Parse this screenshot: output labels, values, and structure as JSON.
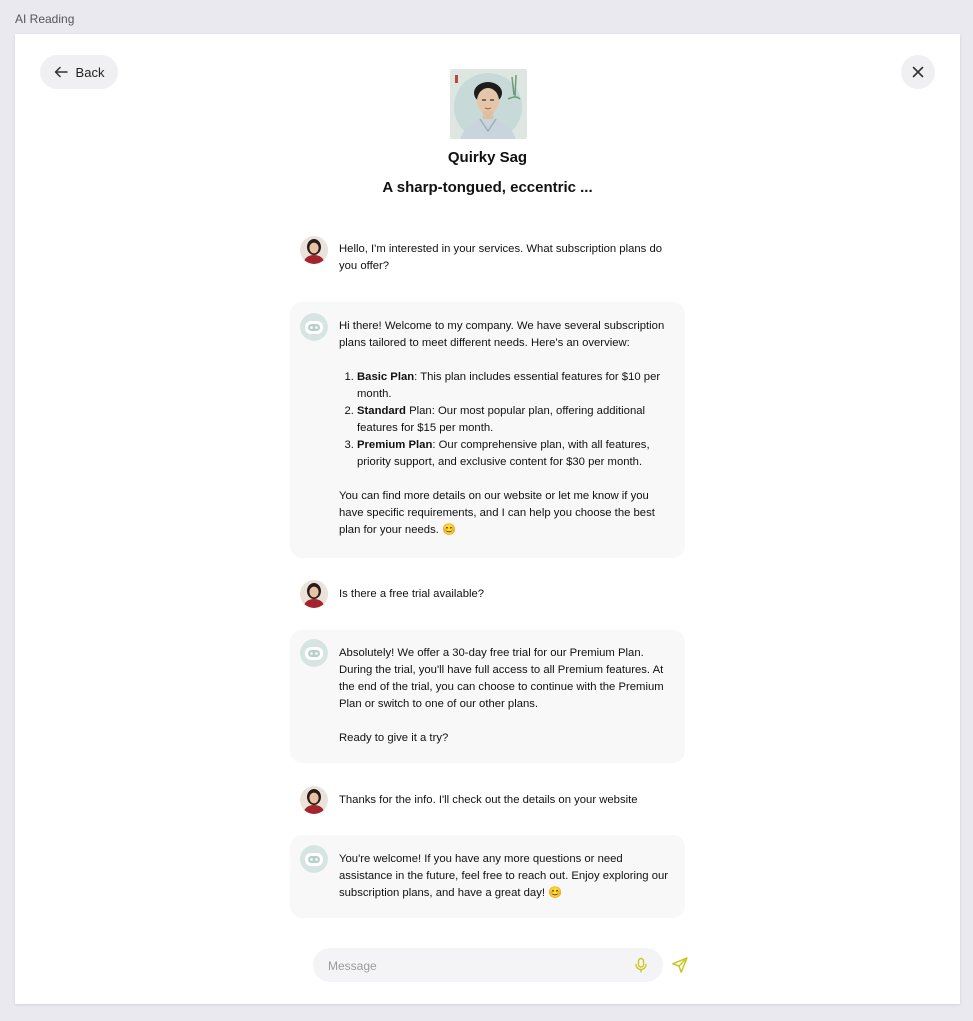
{
  "app": {
    "title": "AI Reading"
  },
  "header": {
    "back_label": "Back",
    "persona_name": "Quirky Sag",
    "persona_description": "A sharp-tongued, eccentric ..."
  },
  "messages": [
    {
      "role": "user",
      "text": "Hello, I'm interested in your services. What subscription plans do you offer?"
    },
    {
      "role": "assistant",
      "intro": "Hi there! Welcome to my company. We have several subscription plans tailored to meet different needs. Here's an overview:",
      "plans": [
        {
          "name": "Basic Plan",
          "desc": ": This plan includes essential features for $10 per month."
        },
        {
          "name": "Standard",
          "desc": " Plan: Our most popular plan, offering additional features for $15 per month."
        },
        {
          "name": "Premium Plan",
          "desc": ": Our comprehensive plan, with all features, priority support, and exclusive content for $30 per month."
        }
      ],
      "outro": "You can find more details on our website or let me know if you have specific requirements, and I can help you choose the best plan for your needs. 😊"
    },
    {
      "role": "user",
      "text": "Is there a free trial available?"
    },
    {
      "role": "assistant",
      "text": "Absolutely! We offer a 30-day free trial for our Premium Plan. During the trial, you'll have full access to all Premium features. At the end of the trial, you can choose to continue with the Premium Plan or switch to one of our other plans.",
      "text2": "Ready to give it a try?"
    },
    {
      "role": "user",
      "text": "Thanks for the info. I'll check out the details on your website"
    },
    {
      "role": "assistant",
      "text": "You're welcome! If you have any more questions or need assistance in the future, feel free to reach out. Enjoy exploring our subscription plans, and have a great day! 😊"
    }
  ],
  "composer": {
    "placeholder": "Message"
  },
  "colors": {
    "accent": "#c8c820",
    "page_bg": "#ebe9f0",
    "bubble_bg": "#f8f8f8"
  },
  "icons": [
    "back-arrow-icon",
    "close-icon",
    "microphone-icon",
    "send-icon",
    "robot-avatar-icon"
  ]
}
